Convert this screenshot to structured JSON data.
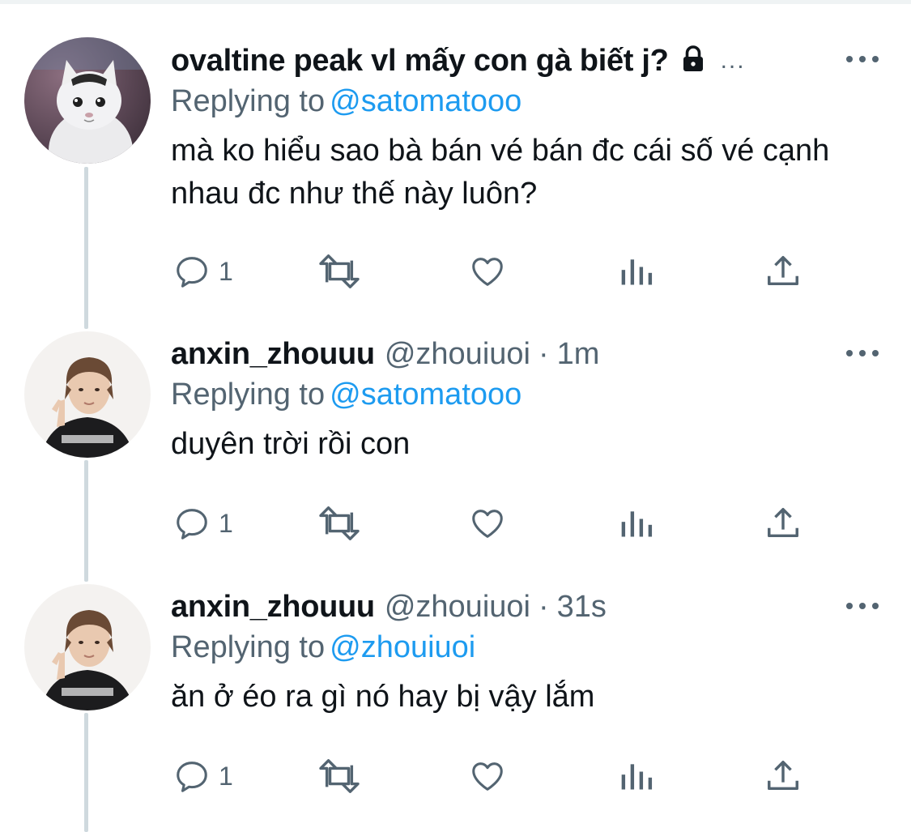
{
  "tweets": [
    {
      "display_name": "ovaltine peak vl mấy con gà biết j?",
      "ellipsis": "...",
      "handle": "",
      "time": "",
      "reply_label": "Replying to",
      "reply_to": "@satomatooo",
      "text": "mà ko hiểu sao bà bán vé bán đc cái số vé cạnh nhau đc như thế này luôn?",
      "reply_count": "1",
      "avatar": "cat-avatar",
      "protected": true
    },
    {
      "display_name": "anxin_zhouuu",
      "handle": "@zhouiuoi",
      "dot": "·",
      "time": "1m",
      "reply_label": "Replying to",
      "reply_to": "@satomatooo",
      "text": "duyên trời rồi con",
      "reply_count": "1",
      "avatar": "person-avatar"
    },
    {
      "display_name": "anxin_zhouuu",
      "handle": "@zhouiuoi",
      "dot": "·",
      "time": "31s",
      "reply_label": "Replying to",
      "reply_to": "@zhouiuoi",
      "text": "ăn ở éo ra gì nó hay bị vậy lắm",
      "reply_count": "1",
      "avatar": "person-avatar"
    }
  ],
  "colors": {
    "link": "#1d9bf0",
    "secondary_text": "#536471",
    "primary_text": "#0f1419",
    "thread_line": "#cfd9de"
  },
  "icons": [
    "reply-icon",
    "retweet-icon",
    "like-icon",
    "views-icon",
    "share-icon",
    "more-icon",
    "lock-icon"
  ]
}
